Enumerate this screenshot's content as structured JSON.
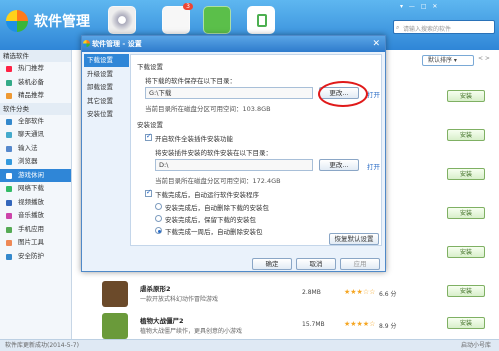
{
  "app": {
    "title": "软件管理",
    "window_controls": "▾ — □ ✕",
    "search_placeholder": "请输入搜索的软件",
    "badge": "3"
  },
  "sidebar": {
    "sections": [
      {
        "label": "精选软件",
        "items": [
          "热门推荐",
          "装机必备",
          "精品推荐"
        ]
      },
      {
        "label": "软件分类",
        "items": [
          "全部软件",
          "聊天通讯",
          "输入法",
          "浏览器",
          "游戏休闲",
          "网络下载",
          "视频播放",
          "音乐播放",
          "手机应用",
          "图片工具",
          "安全防护"
        ]
      }
    ],
    "active": "游戏休闲"
  },
  "list": {
    "sort_label": "默认排序 ▾",
    "pager": "< >",
    "install_label": "安装",
    "apps": [
      {
        "name": "虐杀原形2",
        "desc": "一款开放式科幻动作冒险游戏",
        "size": "2.8MB",
        "stars": "★★★☆☆",
        "score": "6.6 分"
      },
      {
        "name": "植物大战僵尸2",
        "desc": "植物大战僵尸续作，更具创意的小游戏",
        "size": "15.7MB",
        "stars": "★★★★☆",
        "score": "8.9 分"
      }
    ]
  },
  "status": {
    "left": "软件库更新成功(2014-5-7)",
    "right": "启动小号库"
  },
  "dialog": {
    "title": "软件管理 - 设置",
    "close": "✕",
    "nav": [
      "下载设置",
      "升级设置",
      "卸载设置",
      "其它设置",
      "安装位置"
    ],
    "download_section": "下载设置",
    "save_label": "将下载的软件保存在以下目录：",
    "save_path": "G:\\下载",
    "change_label": "更改...",
    "open_label": "打开",
    "save_space": "当前目录所在磁盘分区可用空间：103.8GB",
    "install_section": "安装设置",
    "plugin_check": "开启软件全装插件安装功能",
    "plugin_label": "将安装插件安装的软件安装在以下目录：",
    "plugin_path": "D:\\",
    "plugin_space": "当前目录所在磁盘分区可用空间：172.4GB",
    "after_check": "下载完成后，自动运行软件安装程序",
    "opt1": "安装完成后，自动删除下载的安装包",
    "opt2": "安装完成后，保留下载的安装包",
    "opt3": "下载完成一周后，自动删除安装包",
    "restore": "恢复默认设置",
    "ok": "确定",
    "cancel": "取消",
    "apply": "应用"
  }
}
